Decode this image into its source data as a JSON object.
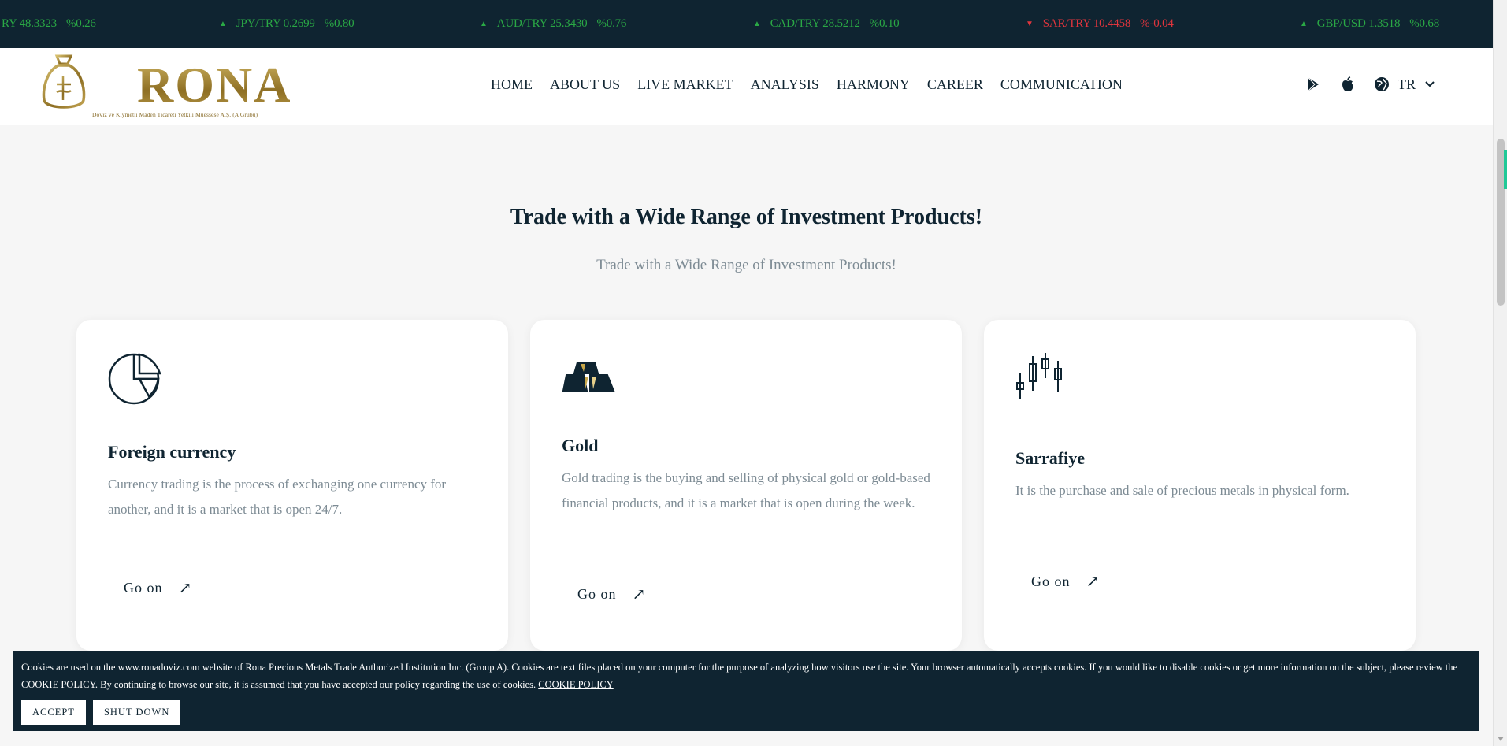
{
  "ticker": [
    {
      "pair": "RY 48.3323",
      "pct": "%0.26",
      "dir": "up",
      "arrow": ""
    },
    {
      "pair": "JPY/TRY 0.2699",
      "pct": "%0.80",
      "dir": "up",
      "arrow": "▲"
    },
    {
      "pair": "AUD/TRY 25.3430",
      "pct": "%0.76",
      "dir": "up",
      "arrow": "▲"
    },
    {
      "pair": "CAD/TRY 28.5212",
      "pct": "%0.10",
      "dir": "up",
      "arrow": "▲"
    },
    {
      "pair": "SAR/TRY 10.4458",
      "pct": "%-0.04",
      "dir": "down",
      "arrow": "▼"
    },
    {
      "pair": "GBP/USD 1.3518",
      "pct": "%0.68",
      "dir": "up",
      "arrow": "▲"
    }
  ],
  "header": {
    "logo_text": "RONA",
    "logo_sub": "Döviz ve Kıymetli Maden Ticareti Yetkili Müessese A.Ş. (A Grubu)",
    "nav": [
      "HOME",
      "ABOUT US",
      "LIVE MARKET",
      "ANALYSIS",
      "HARMONY",
      "CAREER",
      "COMMUNICATION"
    ],
    "lang": "TR"
  },
  "section": {
    "title": "Trade with a Wide Range of Investment Products!",
    "subtitle": "Trade with a Wide Range of Investment Products!"
  },
  "cards": [
    {
      "icon": "pie-chart-icon",
      "title": "Foreign currency",
      "text": "Currency trading is the process of exchanging one currency for another, and it is a market that is open 24/7.",
      "link": "Go on"
    },
    {
      "icon": "gold-bars-icon",
      "title": "Gold",
      "text": "Gold trading is the buying and selling of physical gold or gold-based financial products, and it is a market that is open during the week.",
      "link": "Go on"
    },
    {
      "icon": "candlestick-icon",
      "title": "Sarrafiye",
      "text": "It is the purchase and sale of precious metals in physical form.",
      "link": "Go on"
    }
  ],
  "cookie": {
    "text": "Cookies are used on the www.ronadoviz.com website of Rona Precious Metals Trade Authorized Institution Inc. (Group A). Cookies are text files placed on your computer for the purpose of analyzing how visitors use the site. Your browser automatically accepts cookies. If you would like to disable cookies or get more information on the subject, please review the COOKIE POLICY. By continuing to browse our site, it is assumed that you have accepted our policy regarding the use of cookies.",
    "link": "COOKIE POLICY",
    "accept": "ACCEPT",
    "shutdown": "SHUT DOWN"
  },
  "colors": {
    "navy": "#0f2431",
    "gold": "#a8893a",
    "up": "#2aa845",
    "down": "#e0353d"
  }
}
